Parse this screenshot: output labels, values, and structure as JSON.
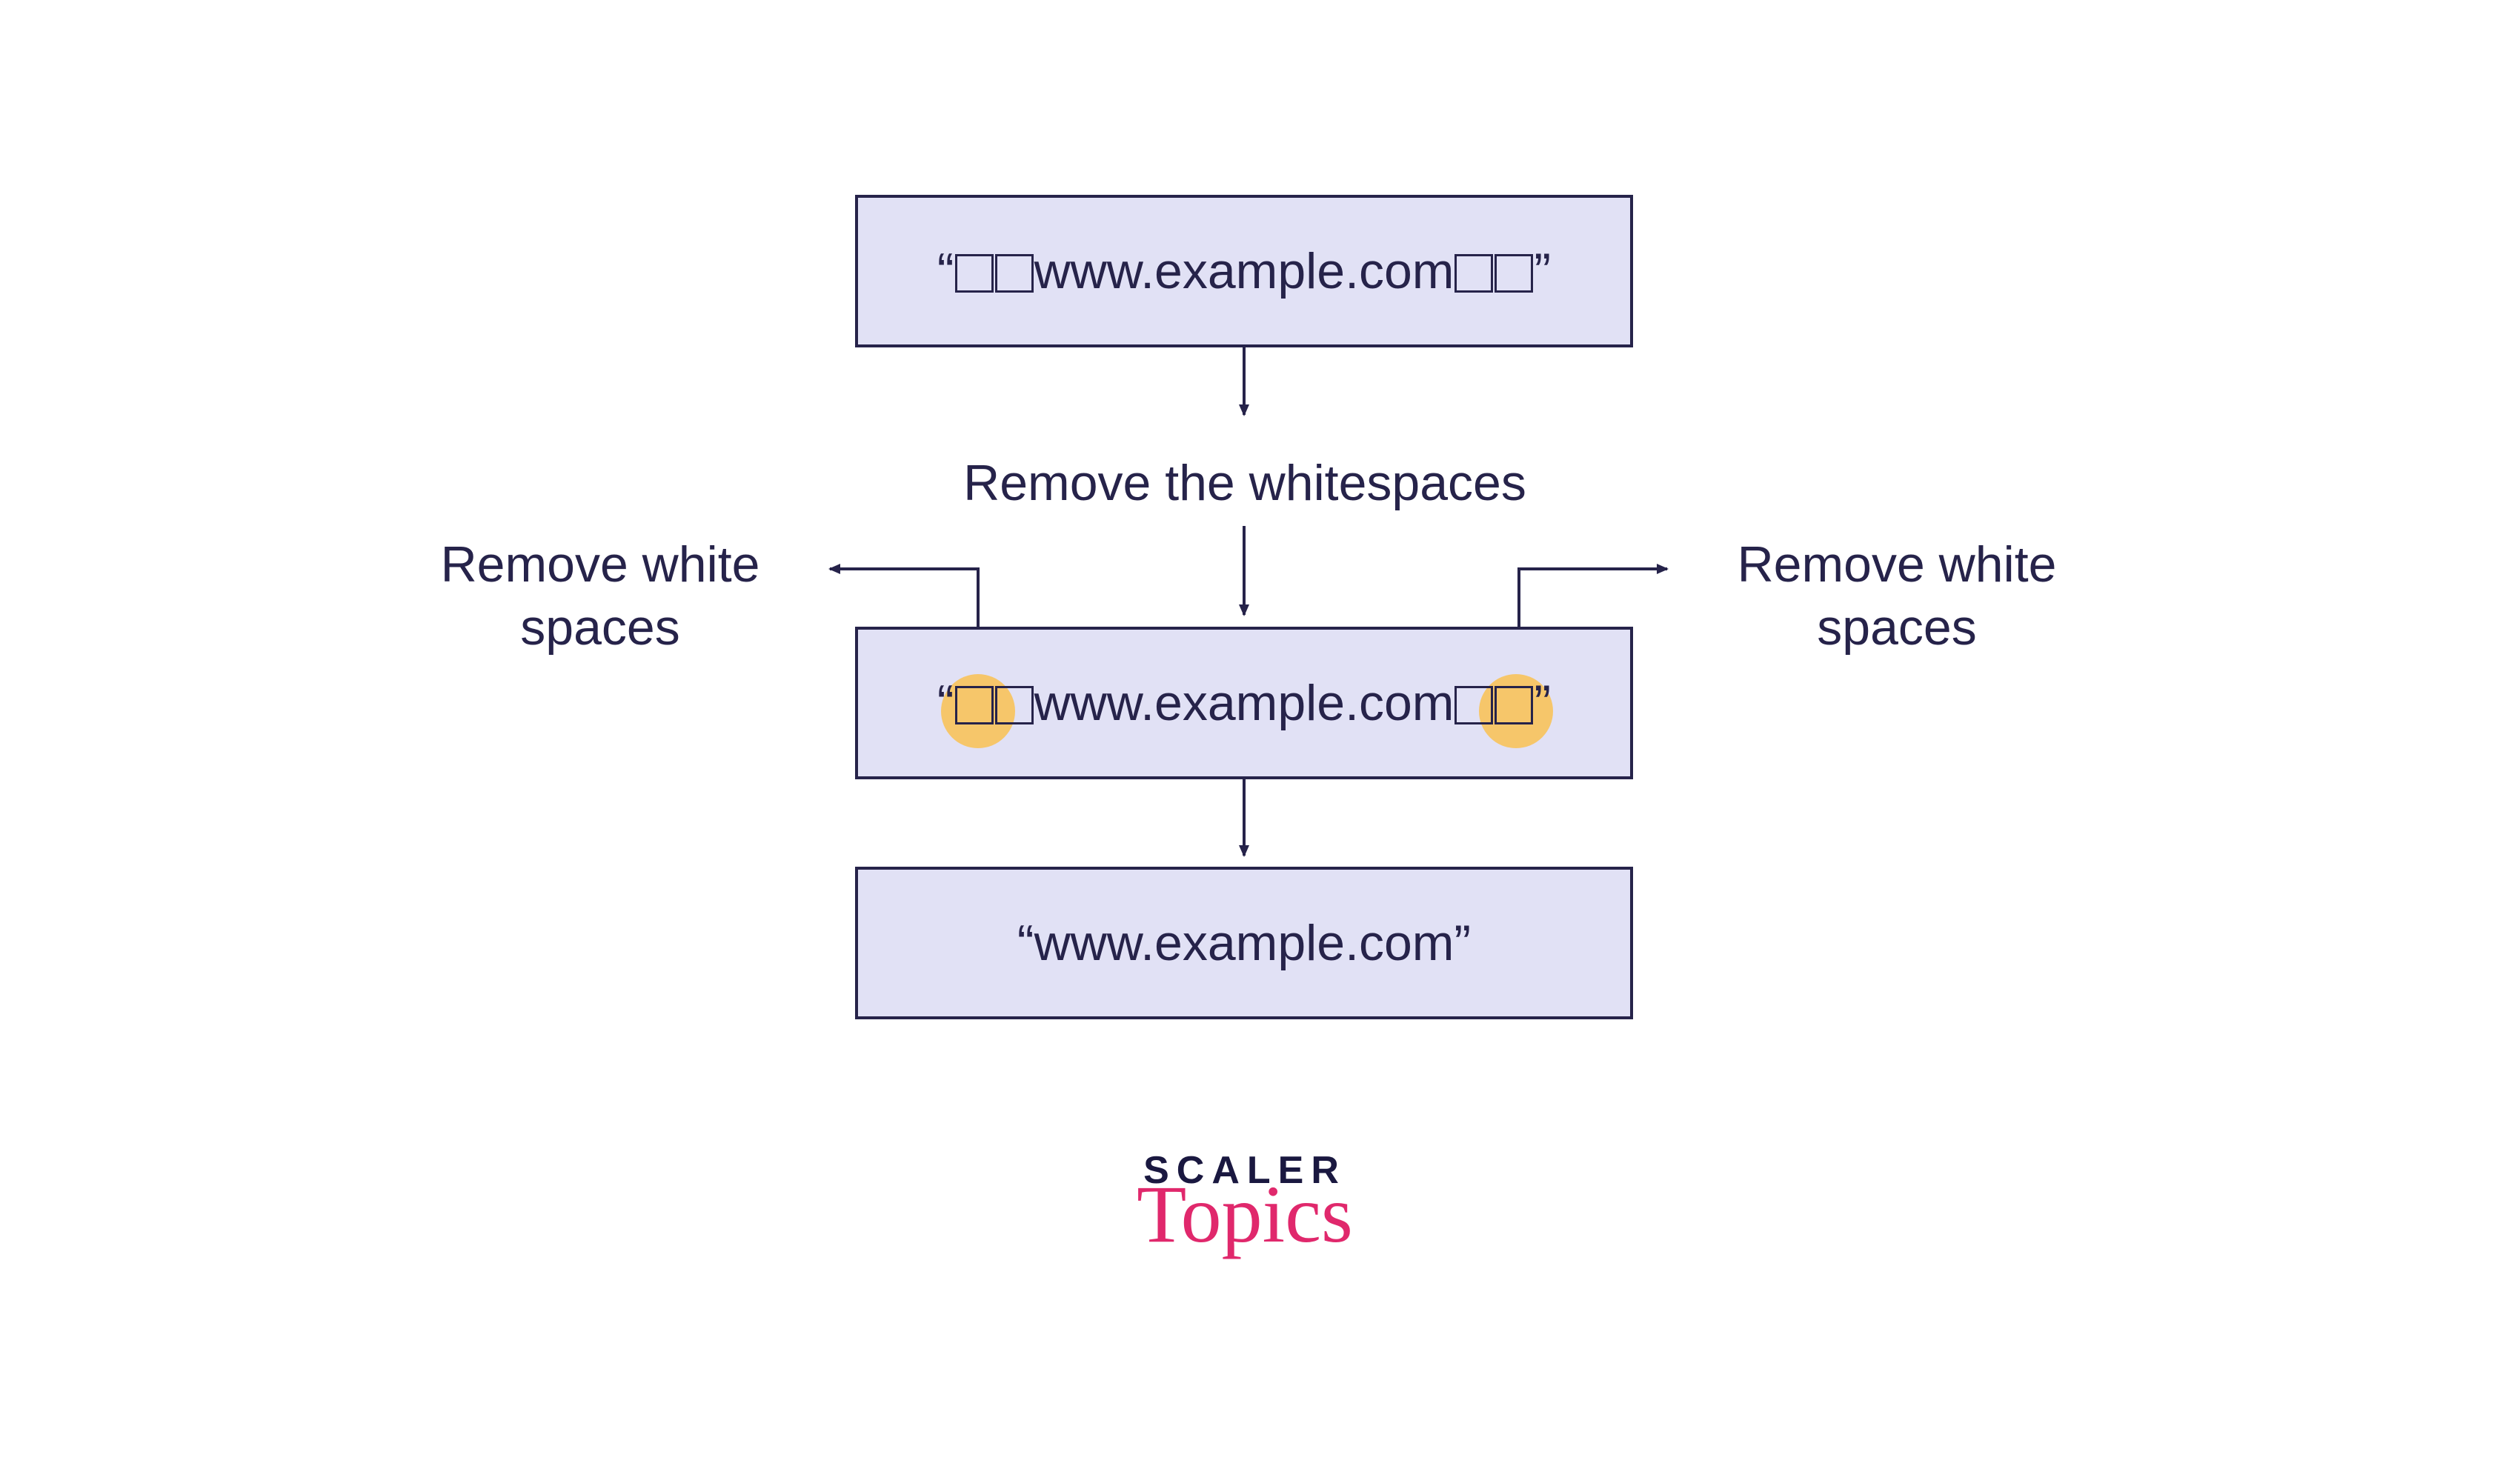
{
  "boxes": {
    "top": {
      "quote_open": "“",
      "quote_close": "”",
      "url": "www.example.com",
      "leading_spaces": 2,
      "trailing_spaces": 2
    },
    "middle": {
      "quote_open": "“",
      "quote_close": "”",
      "url": "www.example.com",
      "leading_spaces": 2,
      "trailing_spaces": 2
    },
    "bottom": {
      "quote_open": "“",
      "quote_close": "”",
      "url": "www.example.com"
    }
  },
  "labels": {
    "step1": "Remove the whitespaces",
    "left_line1": "Remove white",
    "left_line2": "spaces",
    "right_line1": "Remove white",
    "right_line2": "spaces"
  },
  "logo": {
    "line1": "SCALER",
    "line2": "Topics"
  },
  "colors": {
    "box_fill": "#e1e1f5",
    "box_border": "#26234a",
    "text": "#26234a",
    "highlight": "#f6c66a",
    "accent": "#e0286c"
  }
}
